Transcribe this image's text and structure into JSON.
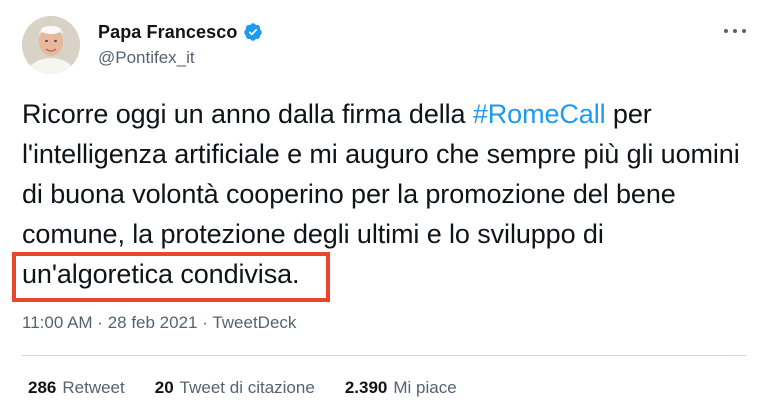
{
  "author": {
    "display_name": "Papa Francesco",
    "handle": "@Pontifex_it",
    "avatar": "pope-portrait-icon",
    "verified": true,
    "verified_color": "#1d9bf0"
  },
  "tweet": {
    "text_before": "Ricorre oggi un anno dalla firma della ",
    "hashtag": "#RomeCall",
    "text_middle": " per l'intelligenza artificiale e mi auguro che sempre più gli uomini di buona volontà cooperino per la promozione del bene comune, la protezione degli ultimi e lo sviluppo di ",
    "text_highlighted": "un'algoretica condivisa.",
    "hashtag_color": "#1d9bf0",
    "highlight_color": "#e8472b"
  },
  "meta": {
    "time": "11:00 AM",
    "separator1": " · ",
    "date": "28 feb 2021",
    "separator2": " · ",
    "source": "TweetDeck"
  },
  "stats": {
    "retweets_count": "286",
    "retweets_label": "Retweet",
    "quotes_count": "20",
    "quotes_label": "Tweet di citazione",
    "likes_count": "2.390",
    "likes_label": "Mi piace"
  }
}
